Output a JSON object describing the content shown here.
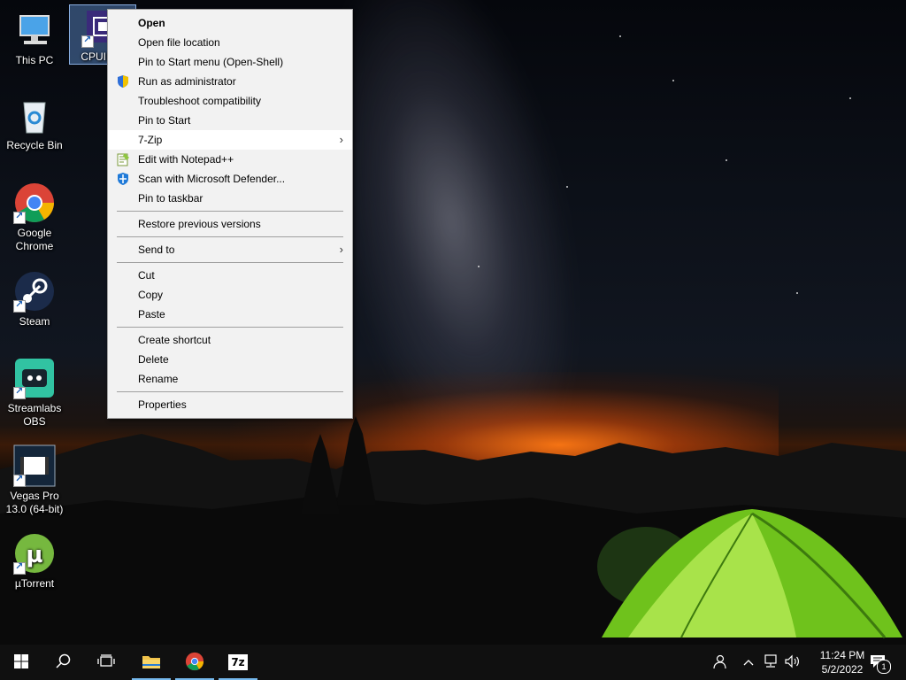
{
  "desktop": {
    "icons": [
      {
        "label": "This PC",
        "icon": "this-pc-icon"
      },
      {
        "label": "CPUID C",
        "icon": "cpuid-icon"
      },
      {
        "label": "Recycle Bin",
        "icon": "recycle-bin-icon"
      },
      {
        "label": "Google Chrome",
        "icon": "chrome-icon"
      },
      {
        "label": "Steam",
        "icon": "steam-icon"
      },
      {
        "label": "Streamlabs OBS",
        "icon": "streamlabs-icon"
      },
      {
        "label": "Vegas Pro 13.0 (64-bit)",
        "icon": "vegas-icon"
      },
      {
        "label": "µTorrent",
        "icon": "utorrent-icon"
      }
    ]
  },
  "context_menu": {
    "groups": [
      [
        {
          "label": "Open",
          "bold": true
        },
        {
          "label": "Open file location"
        },
        {
          "label": "Pin to Start menu (Open-Shell)"
        },
        {
          "label": "Run as administrator",
          "icon": "uac-shield-icon"
        },
        {
          "label": "Troubleshoot compatibility"
        },
        {
          "label": "Pin to Start"
        },
        {
          "label": "7-Zip",
          "submenu": true,
          "highlighted": true
        },
        {
          "label": "Edit with Notepad++",
          "icon": "notepadpp-icon"
        },
        {
          "label": "Scan with Microsoft Defender...",
          "icon": "defender-icon"
        },
        {
          "label": "Pin to taskbar"
        }
      ],
      [
        {
          "label": "Restore previous versions"
        }
      ],
      [
        {
          "label": "Send to",
          "submenu": true
        }
      ],
      [
        {
          "label": "Cut"
        },
        {
          "label": "Copy"
        },
        {
          "label": "Paste"
        }
      ],
      [
        {
          "label": "Create shortcut"
        },
        {
          "label": "Delete"
        },
        {
          "label": "Rename"
        }
      ],
      [
        {
          "label": "Properties"
        }
      ]
    ]
  },
  "taskbar": {
    "pinned": [
      {
        "name": "file-explorer",
        "icon": "folder-icon"
      },
      {
        "name": "chrome",
        "icon": "chrome-icon"
      },
      {
        "name": "7zip",
        "icon": "7zip-icon",
        "text": "7z"
      }
    ],
    "clock": {
      "time": "11:24 PM",
      "date": "5/2/2022"
    },
    "notifications_count": "1"
  },
  "colors": {
    "menu_bg": "#f2f2f2",
    "menu_hover": "#ffffff",
    "taskbar_bg": "#101010",
    "active_indicator": "#76b9ed"
  }
}
